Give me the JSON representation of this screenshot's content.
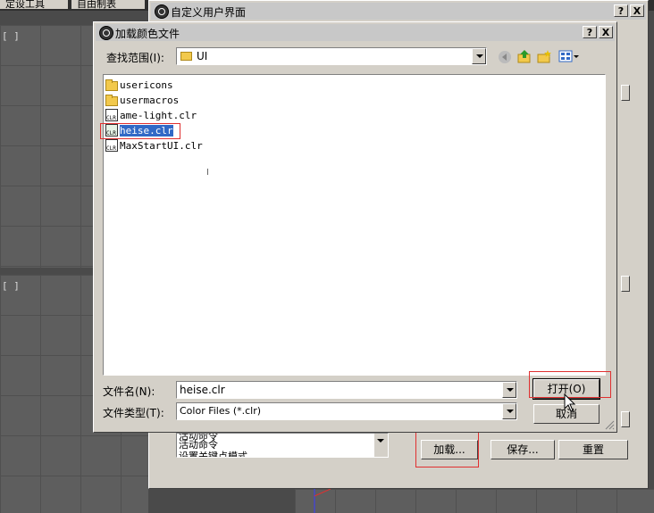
{
  "background_window": {
    "tab1": "定设工具",
    "tab2": "自由制表",
    "viewport_label_1": "[ ]",
    "viewport_label_2": "[ ]"
  },
  "customize_window": {
    "title": "自定义用户界面",
    "help_btn": "?",
    "close_btn": "X",
    "list_items": [
      "活动命令",
      "活动命令",
      "设置关键点模式"
    ],
    "load_btn": "加载...",
    "save_btn": "保存...",
    "reset_btn": "重置"
  },
  "load_dialog": {
    "title": "加载颜色文件",
    "help_btn": "?",
    "close_btn": "X",
    "look_in_label": "查找范围(I):",
    "look_in_value": "UI",
    "files": [
      {
        "name": "usericons",
        "type": "folder"
      },
      {
        "name": "usermacros",
        "type": "folder"
      },
      {
        "name": "ame-light.clr",
        "type": "clr"
      },
      {
        "name": "heise.clr",
        "type": "clr",
        "selected": true
      },
      {
        "name": "MaxStartUI.clr",
        "type": "clr"
      }
    ],
    "filename_label": "文件名(N):",
    "filename_value": "heise.clr",
    "filetype_label": "文件类型(T):",
    "filetype_value": "Color Files (*.clr)",
    "open_btn": "打开(O)",
    "cancel_btn": "取消"
  },
  "colors": {
    "highlight": "#3169c6",
    "annotation_red": "#e03030",
    "dialog_bg": "#d4d0c8"
  }
}
